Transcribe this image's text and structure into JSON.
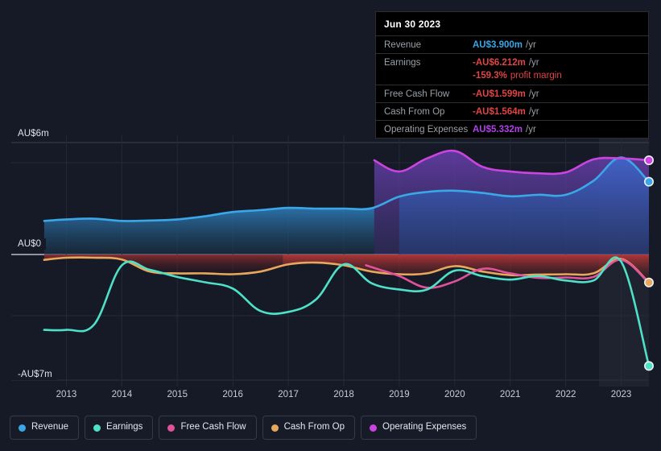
{
  "axes": {
    "y_top_label": "AU$6m",
    "y_zero_label": "AU$0",
    "y_bottom_label": "-AU$7m",
    "x_ticks": [
      "2013",
      "2014",
      "2015",
      "2016",
      "2017",
      "2018",
      "2019",
      "2020",
      "2021",
      "2022",
      "2023"
    ]
  },
  "legend": [
    {
      "label": "Revenue",
      "color": "#3aa7e8"
    },
    {
      "label": "Earnings",
      "color": "#4fe0c8"
    },
    {
      "label": "Free Cash Flow",
      "color": "#e0529a"
    },
    {
      "label": "Cash From Op",
      "color": "#e8a85c"
    },
    {
      "label": "Operating Expenses",
      "color": "#cc44e0"
    }
  ],
  "tooltip": {
    "date": "Jun 30 2023",
    "rows": [
      {
        "key": "Revenue",
        "value": "AU$3.900m",
        "unit": "/yr",
        "color": "#3aa7e8"
      },
      {
        "key": "Earnings",
        "value": "-AU$6.212m",
        "unit": "/yr",
        "color": "#e04545"
      },
      {
        "key": "",
        "value": "-159.3%",
        "note": "profit margin",
        "color": "#e04545",
        "sub": true
      },
      {
        "key": "Free Cash Flow",
        "value": "-AU$1.599m",
        "unit": "/yr",
        "color": "#e04545"
      },
      {
        "key": "Cash From Op",
        "value": "-AU$1.564m",
        "unit": "/yr",
        "color": "#e04545"
      },
      {
        "key": "Operating Expenses",
        "value": "AU$5.332m",
        "unit": "/yr",
        "color": "#b040e8"
      }
    ]
  },
  "chart_data": {
    "type": "area",
    "title": "",
    "xlabel": "",
    "ylabel": "",
    "currency": "AU$",
    "units": "millions per year",
    "ylim": [
      -7,
      6
    ],
    "xlim": [
      2012.5,
      2023.5
    ],
    "grid": true,
    "legend_position": "bottom-left",
    "zero_line": 0,
    "highlight_band": {
      "from": 2022.6,
      "to": 2023.5,
      "label": "Jun 30 2023"
    },
    "series": [
      {
        "name": "Revenue",
        "color": "#3aa7e8",
        "x": [
          2012.6,
          2013.0,
          2013.5,
          2014.0,
          2014.5,
          2015.0,
          2015.5,
          2016.0,
          2016.5,
          2017.0,
          2017.5,
          2018.0,
          2018.5,
          2019.0,
          2019.5,
          2020.0,
          2020.5,
          2021.0,
          2021.5,
          2022.0,
          2022.5,
          2023.0,
          2023.5
        ],
        "values": [
          1.8,
          1.88,
          1.92,
          1.8,
          1.82,
          1.88,
          2.05,
          2.28,
          2.38,
          2.5,
          2.46,
          2.46,
          2.48,
          3.1,
          3.35,
          3.42,
          3.3,
          3.12,
          3.2,
          3.2,
          3.95,
          5.2,
          3.9
        ]
      },
      {
        "name": "Earnings",
        "color": "#4fe0c8",
        "x": [
          2012.6,
          2013.0,
          2013.5,
          2014.0,
          2014.5,
          2015.0,
          2015.5,
          2016.0,
          2016.5,
          2017.0,
          2017.5,
          2018.0,
          2018.5,
          2019.0,
          2019.5,
          2020.0,
          2020.5,
          2021.0,
          2021.5,
          2022.0,
          2022.5,
          2023.0,
          2023.5
        ],
        "values": [
          -4.2,
          -4.2,
          -3.9,
          -0.6,
          -0.85,
          -1.25,
          -1.55,
          -1.9,
          -3.15,
          -3.2,
          -2.5,
          -0.55,
          -1.6,
          -1.95,
          -1.95,
          -0.9,
          -1.2,
          -1.4,
          -1.2,
          -1.45,
          -1.45,
          -0.4,
          -6.21
        ]
      },
      {
        "name": "Free Cash Flow",
        "color": "#e0529a",
        "x": [
          2018.4,
          2018.6,
          2019.0,
          2019.5,
          2020.0,
          2020.5,
          2021.0,
          2021.5,
          2022.0,
          2022.5,
          2023.0,
          2023.5
        ],
        "values": [
          -0.6,
          -0.8,
          -1.2,
          -1.85,
          -1.5,
          -0.8,
          -1.05,
          -1.3,
          -1.28,
          -1.25,
          -0.3,
          -1.6
        ]
      },
      {
        "name": "Cash From Op",
        "color": "#e8a85c",
        "x": [
          2012.6,
          2013.0,
          2013.5,
          2014.0,
          2014.5,
          2015.0,
          2015.5,
          2016.0,
          2016.5,
          2017.0,
          2017.5,
          2018.0,
          2018.5,
          2019.0,
          2019.5,
          2020.0,
          2020.5,
          2021.0,
          2021.5,
          2022.0,
          2022.5,
          2023.0,
          2023.5
        ],
        "values": [
          -0.3,
          -0.18,
          -0.18,
          -0.28,
          -0.95,
          -1.05,
          -1.05,
          -1.1,
          -0.95,
          -0.55,
          -0.45,
          -0.6,
          -0.95,
          -1.1,
          -1.05,
          -0.65,
          -0.95,
          -1.15,
          -1.12,
          -1.1,
          -1.05,
          -0.25,
          -1.56
        ]
      },
      {
        "name": "Operating Expenses",
        "color": "#cc44e0",
        "x": [
          2018.55,
          2019.0,
          2019.5,
          2020.0,
          2020.5,
          2021.0,
          2021.5,
          2022.0,
          2022.5,
          2023.0,
          2023.5
        ],
        "values": [
          5.05,
          4.45,
          5.15,
          5.55,
          4.7,
          4.45,
          4.35,
          4.4,
          5.1,
          5.15,
          5.05
        ]
      }
    ]
  }
}
